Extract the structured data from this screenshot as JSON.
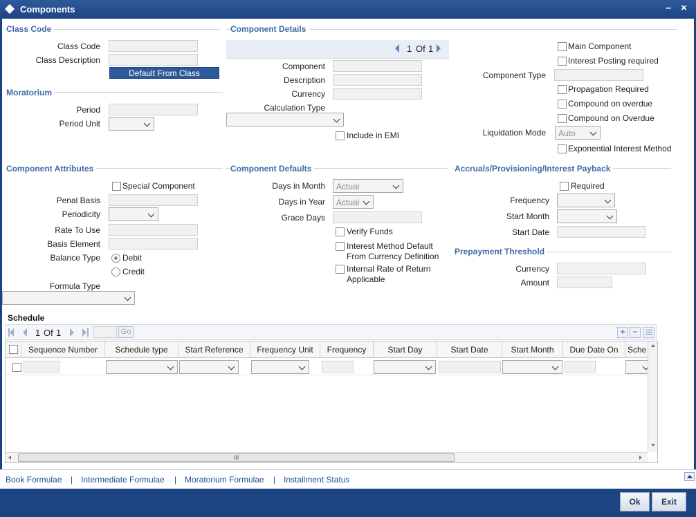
{
  "window": {
    "title": "Components",
    "minimize": "–",
    "close": "×"
  },
  "class_code": {
    "section": "Class Code",
    "class_code_label": "Class Code",
    "class_description_label": "Class Description",
    "default_button": "Default From Class"
  },
  "moratorium": {
    "section": "Moratorium",
    "period_label": "Period",
    "period_unit_label": "Period Unit"
  },
  "component_details": {
    "section": "Component Details",
    "pager": {
      "current": "1",
      "of": "Of",
      "total": "1"
    },
    "component_label": "Component",
    "description_label": "Description",
    "currency_label": "Currency",
    "calculation_type_label": "Calculation Type",
    "include_in_emi": "Include in EMI"
  },
  "right_panel": {
    "main_component": "Main Component",
    "interest_posting": "Interest Posting required",
    "component_type_label": "Component Type",
    "propagation_required": "Propagation Required",
    "compound_on_overdue_1": "Compound on overdue",
    "compound_on_overdue_2": "Compound on Overdue",
    "liquidation_mode_label": "Liquidation Mode",
    "liquidation_mode_value": "Auto",
    "exponential_interest": "Exponential Interest Method"
  },
  "component_attributes": {
    "section": "Component Attributes",
    "special_component": "Special Component",
    "penal_basis_label": "Penal Basis",
    "periodicity_label": "Periodicity",
    "rate_to_use_label": "Rate To Use",
    "basis_element_label": "Basis Element",
    "balance_type_label": "Balance Type",
    "debit": "Debit",
    "credit": "Credit",
    "formula_type_label": "Formula Type"
  },
  "component_defaults": {
    "section": "Component Defaults",
    "days_in_month_label": "Days in Month",
    "days_in_month_value": "Actual",
    "days_in_year_label": "Days in Year",
    "days_in_year_value": "Actual",
    "grace_days_label": "Grace Days",
    "verify_funds": "Verify Funds",
    "interest_method_default_1": "Interest Method Default",
    "interest_method_default_2": "From Currency Definition",
    "irr_1": "Internal Rate of Return",
    "irr_2": "Applicable"
  },
  "accruals": {
    "section": "Accruals/Provisioning/Interest Payback",
    "required": "Required",
    "frequency_label": "Frequency",
    "start_month_label": "Start Month",
    "start_date_label": "Start Date"
  },
  "prepayment": {
    "section": "Prepayment Threshold",
    "currency_label": "Currency",
    "amount_label": "Amount"
  },
  "schedule": {
    "section": "Schedule",
    "pager": {
      "current": "1",
      "of": "Of",
      "total": "1"
    },
    "go": "Go",
    "columns": [
      "Sequence Number",
      "Schedule type",
      "Start Reference",
      "Frequency Unit",
      "Frequency",
      "Start Day",
      "Start Date",
      "Start Month",
      "Due Date On",
      "Sche"
    ],
    "scroll_grip": "III"
  },
  "footer": {
    "links": [
      "Book Formulae",
      "Intermediate Formulae",
      "Moratorium Formulae",
      "Installment Status"
    ],
    "separator": "|"
  },
  "buttons": {
    "ok": "Ok",
    "exit": "Exit"
  },
  "colors": {
    "title_bar": "#1d4482",
    "section_heading": "#3e6aa6",
    "button_blue": "#2f5a9a"
  }
}
